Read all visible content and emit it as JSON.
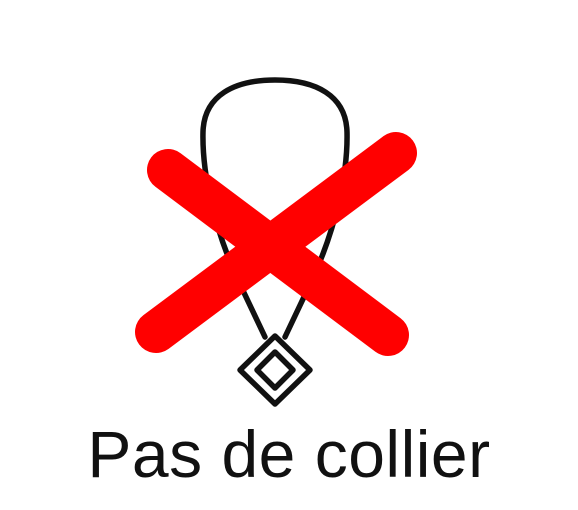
{
  "sign": {
    "caption": "Pas de collier",
    "icon": "necklace-icon",
    "prohibition": "cross-icon",
    "colors": {
      "background": "#ffffff",
      "necklace": "#111111",
      "cross": "#ff0000",
      "text": "#111111"
    }
  }
}
